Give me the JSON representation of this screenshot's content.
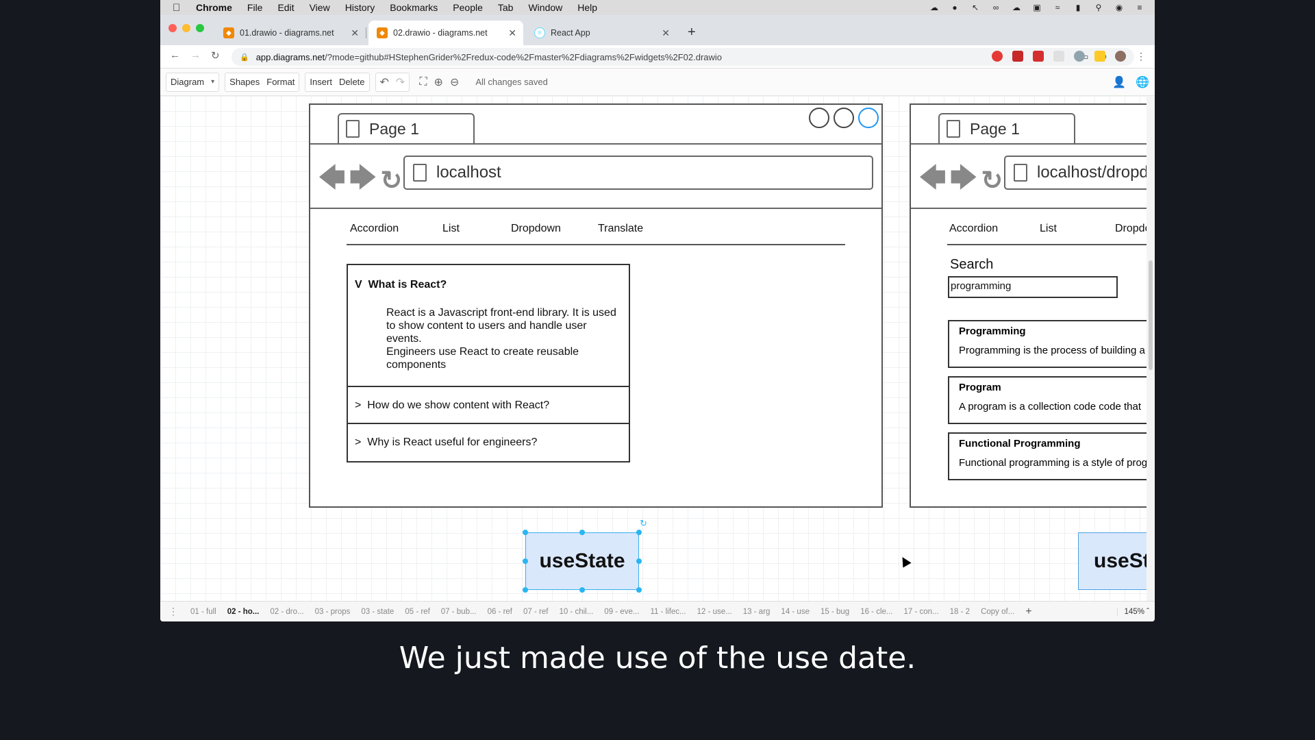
{
  "menubar": {
    "app": "Chrome",
    "items": [
      "File",
      "Edit",
      "View",
      "History",
      "Bookmarks",
      "People",
      "Tab",
      "Window",
      "Help"
    ]
  },
  "browser": {
    "tabs": [
      {
        "title": "01.drawio - diagrams.net"
      },
      {
        "title": "02.drawio - diagrams.net"
      },
      {
        "title": "React App"
      }
    ],
    "url_host": "app.diagrams.net",
    "url_path": "/?mode=github#HStephenGrider%2Fredux-code%2Fmaster%2Fdiagrams%2Fwidgets%2F02.drawio"
  },
  "toolbar": {
    "diagram": "Diagram",
    "shapes": "Shapes",
    "format": "Format",
    "insert": "Insert",
    "delete": "Delete",
    "status": "All changes saved"
  },
  "mock1": {
    "page_tab": "Page 1",
    "address": "localhost",
    "nav": [
      "Accordion",
      "List",
      "Dropdown",
      "Translate"
    ],
    "accordion": {
      "open_marker": "V",
      "open_title": "What is React?",
      "open_body": [
        "React is a Javascript front-end library. It is used",
        "to show content to users and handle user",
        "events.",
        "Engineers use React to create reusable",
        "components"
      ],
      "items": [
        {
          "marker": ">",
          "title": "How do we show content with React?"
        },
        {
          "marker": ">",
          "title": "Why is React useful for engineers?"
        }
      ]
    }
  },
  "mock2": {
    "page_tab": "Page 1",
    "address": "localhost/dropdo",
    "nav": [
      "Accordion",
      "List",
      "Dropdo"
    ],
    "search_label": "Search",
    "search_value": "programming",
    "results": [
      {
        "title": "Programming",
        "body": "Programming is the process of building a"
      },
      {
        "title": "Program",
        "body": "A program is a collection code code that"
      },
      {
        "title": "Functional Programming",
        "body": "Functional programming is a style of prog"
      }
    ]
  },
  "usestate_label": "useState",
  "usestate_partial": "useSt",
  "pages": [
    "01 - full",
    "02 - ho...",
    "02 - dro...",
    "03 - props",
    "03 - state",
    "05 - ref",
    "07 - bub...",
    "06 - ref",
    "07 - ref",
    "10 - chil...",
    "09 - eve...",
    "11 - lifec...",
    "12 - use...",
    "13 - arg",
    "14 - use",
    "15 - bug",
    "16 - cle...",
    "17 - con...",
    "18 - 2",
    "Copy of..."
  ],
  "zoom": "145%",
  "caption": "We just made use of the use date."
}
